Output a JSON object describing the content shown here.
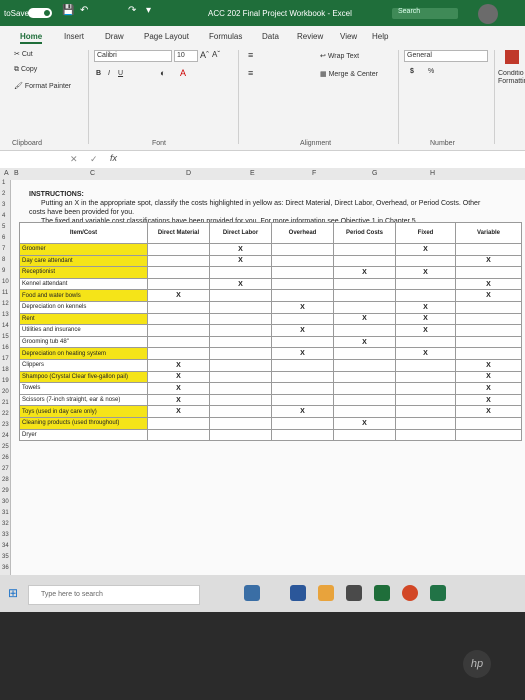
{
  "titlebar": {
    "autosave_label": "toSave",
    "toggle_label": "On",
    "title": "ACC 202 Final Project Workbook - Excel",
    "search_placeholder": "Search"
  },
  "ribbon_tabs": [
    "Home",
    "Insert",
    "Draw",
    "Page Layout",
    "Formulas",
    "Data",
    "Review",
    "View",
    "Help"
  ],
  "clipboard": {
    "cut": "Cut",
    "copy": "Copy",
    "format_painter": "Format Painter",
    "group": "Clipboard"
  },
  "font": {
    "name": "Calibri",
    "size": "10",
    "group": "Font"
  },
  "alignment": {
    "wrap": "Wrap Text",
    "merge": "Merge & Center",
    "group": "Alignment"
  },
  "number": {
    "format": "General",
    "currency": "$",
    "percent": "%",
    "group": "Number"
  },
  "styles": {
    "conditional": "Conditio Formattin"
  },
  "columns": [
    "A",
    "B",
    "C",
    "D",
    "E",
    "F",
    "G",
    "H"
  ],
  "rows": [
    "1",
    "2",
    "3",
    "4",
    "5",
    "6",
    "7",
    "8",
    "9",
    "10",
    "11",
    "12",
    "13",
    "14",
    "15",
    "16",
    "17",
    "18",
    "19",
    "20",
    "21",
    "22",
    "23",
    "24",
    "25",
    "26",
    "27",
    "28",
    "29",
    "30",
    "31",
    "32",
    "33",
    "34",
    "35",
    "36"
  ],
  "instructions": {
    "heading": "INSTRUCTIONS:",
    "line1": "Putting an X in the appropriate spot, classify the costs highlighted in yellow as: Direct Material, Direct Labor, Overhead, or Period Costs. Other",
    "line2": "costs have been provided for you.",
    "line3": "The fixed and variable cost classifications have been provided for you. For more information see Objective 1 in Chapter 5."
  },
  "table": {
    "headers": [
      "Item/Cost",
      "Direct Material",
      "Direct Labor",
      "Overhead",
      "Period Costs",
      "Fixed",
      "Variable"
    ],
    "rows": [
      {
        "item": "Groomer",
        "dm": "",
        "dl": "X",
        "oh": "",
        "pc": "",
        "fx": "X",
        "vr": "",
        "hl": true
      },
      {
        "item": "Day care attendant",
        "dm": "",
        "dl": "X",
        "oh": "",
        "pc": "",
        "fx": "",
        "vr": "X",
        "hl": true
      },
      {
        "item": "Receptionist",
        "dm": "",
        "dl": "",
        "oh": "",
        "pc": "X",
        "fx": "X",
        "vr": "",
        "hl": true
      },
      {
        "item": "Kennel attendant",
        "dm": "",
        "dl": "X",
        "oh": "",
        "pc": "",
        "fx": "",
        "vr": "X",
        "hl": false
      },
      {
        "item": "Food and water bowls",
        "dm": "X",
        "dl": "",
        "oh": "",
        "pc": "",
        "fx": "",
        "vr": "X",
        "hl": true
      },
      {
        "item": "Depreciation on kennels",
        "dm": "",
        "dl": "",
        "oh": "X",
        "pc": "",
        "fx": "X",
        "vr": "",
        "hl": false
      },
      {
        "item": "Rent",
        "dm": "",
        "dl": "",
        "oh": "",
        "pc": "X",
        "fx": "X",
        "vr": "",
        "hl": true
      },
      {
        "item": "Utilities and insurance",
        "dm": "",
        "dl": "",
        "oh": "X",
        "pc": "",
        "fx": "X",
        "vr": "",
        "hl": false
      },
      {
        "item": "Grooming tub 48\"",
        "dm": "",
        "dl": "",
        "oh": "",
        "pc": "X",
        "fx": "",
        "vr": "",
        "hl": false
      },
      {
        "item": "Depreciation on heating system",
        "dm": "",
        "dl": "",
        "oh": "X",
        "pc": "",
        "fx": "X",
        "vr": "",
        "hl": true
      },
      {
        "item": "Clippers",
        "dm": "X",
        "dl": "",
        "oh": "",
        "pc": "",
        "fx": "",
        "vr": "X",
        "hl": false
      },
      {
        "item": "Shampoo (Crystal Clear five-gallon pail)",
        "dm": "X",
        "dl": "",
        "oh": "",
        "pc": "",
        "fx": "",
        "vr": "X",
        "hl": true
      },
      {
        "item": "Towels",
        "dm": "X",
        "dl": "",
        "oh": "",
        "pc": "",
        "fx": "",
        "vr": "X",
        "hl": false
      },
      {
        "item": "Scissors (7-inch straight, ear & nose)",
        "dm": "X",
        "dl": "",
        "oh": "",
        "pc": "",
        "fx": "",
        "vr": "X",
        "hl": false
      },
      {
        "item": "Toys (used in day care only)",
        "dm": "X",
        "dl": "",
        "oh": "X",
        "pc": "",
        "fx": "",
        "vr": "X",
        "hl": true
      },
      {
        "item": "Cleaning products (used throughout)",
        "dm": "",
        "dl": "",
        "oh": "",
        "pc": "X",
        "fx": "",
        "vr": "",
        "hl": true
      },
      {
        "item": "Dryer",
        "dm": "",
        "dl": "",
        "oh": "",
        "pc": "",
        "fx": "",
        "vr": "",
        "hl": false
      }
    ]
  },
  "taskbar": {
    "search_placeholder": "Type here to search"
  },
  "brand": {
    "logo": "hp"
  },
  "colors": {
    "excel_green": "#1f6e3a",
    "highlight_yellow": "#f5e418"
  }
}
